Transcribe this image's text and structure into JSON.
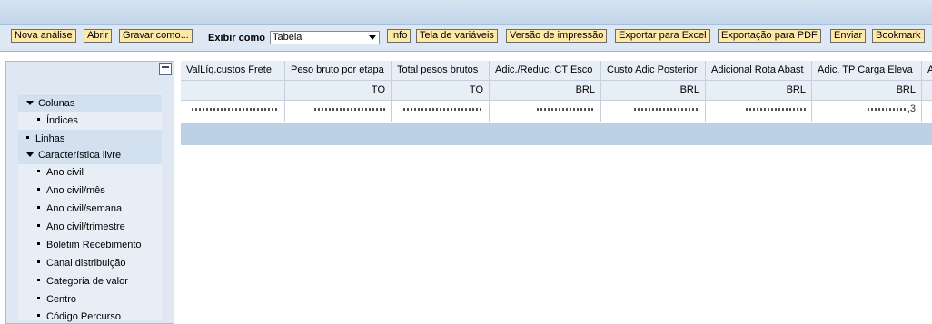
{
  "toolbar": {
    "buttons": [
      {
        "label": "Nova análise"
      },
      {
        "label": "Abrir"
      },
      {
        "label": "Gravar como..."
      },
      {
        "label": "Info"
      },
      {
        "label": "Tela de variáveis"
      },
      {
        "label": "Versão de impressão"
      },
      {
        "label": "Exportar para Excel"
      },
      {
        "label": "Exportação para PDF"
      },
      {
        "label": "Enviar"
      },
      {
        "label": "Bookmark"
      }
    ],
    "show_as_label": "Exibir como",
    "show_as_value": "Tabela"
  },
  "navigation": {
    "items": [
      {
        "label": "Colunas",
        "kind": "expanded"
      },
      {
        "label": "Índices",
        "kind": "child"
      },
      {
        "label": "Linhas",
        "kind": "leaf"
      },
      {
        "label": "Característica livre",
        "kind": "expanded"
      },
      {
        "label": "Ano civil",
        "kind": "child"
      },
      {
        "label": "Ano civil/mês",
        "kind": "child"
      },
      {
        "label": "Ano civil/semana",
        "kind": "child"
      },
      {
        "label": "Ano civil/trimestre",
        "kind": "child"
      },
      {
        "label": "Boletim Recebimento",
        "kind": "child"
      },
      {
        "label": "Canal distribuição",
        "kind": "child"
      },
      {
        "label": "Categoria de valor",
        "kind": "child"
      },
      {
        "label": "Centro",
        "kind": "child"
      },
      {
        "label": "Código Percurso",
        "kind": "child"
      }
    ]
  },
  "table": {
    "headers": [
      "ValLíq.custos Frete",
      "Peso bruto por etapa",
      "Total pesos brutos",
      "Adic./Reduc. CT Esco",
      "Custo Adic Posterior",
      "Adicional Rota Abast",
      "Adic. TP Carga Eleva",
      "A"
    ],
    "units": [
      "",
      "TO",
      "TO",
      "BRL",
      "BRL",
      "BRL",
      "BRL",
      ""
    ],
    "last_cell_visible_tail": ",3"
  }
}
